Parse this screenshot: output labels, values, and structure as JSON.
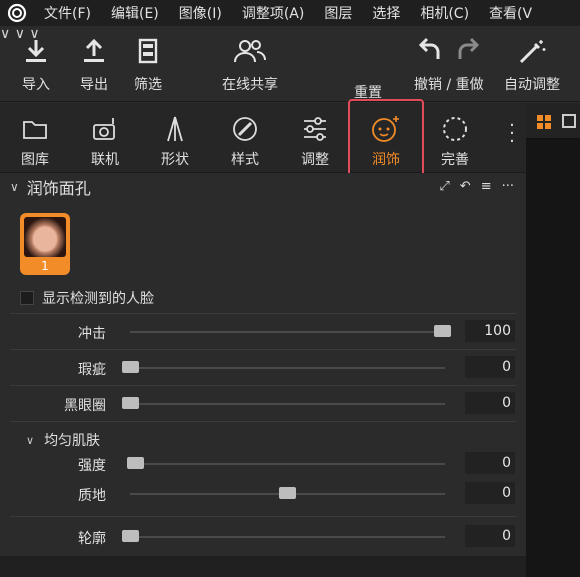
{
  "menu": [
    "文件(F)",
    "编辑(E)",
    "图像(I)",
    "调整项(A)",
    "图层",
    "选择",
    "相机(C)",
    "查看(V"
  ],
  "toolbar": {
    "import": "导入",
    "export": "导出",
    "filter": "筛选",
    "share": "在线共享",
    "reset": "重置",
    "undo_redo": "撤销 / 重做",
    "auto_adjust": "自动调整"
  },
  "tabs": [
    {
      "label": "图库",
      "icon": "folder-icon"
    },
    {
      "label": "联机",
      "icon": "camera-tether-icon"
    },
    {
      "label": "形状",
      "icon": "shape-icon"
    },
    {
      "label": "样式",
      "icon": "style-icon"
    },
    {
      "label": "调整",
      "icon": "sliders-icon"
    },
    {
      "label": "润饰",
      "icon": "retouch-face-icon",
      "active": true
    },
    {
      "label": "完善",
      "icon": "refine-circle-icon"
    }
  ],
  "panel": {
    "title": "润饰面孔",
    "face_count": "1",
    "show_faces_label": "显示检测到的人脸",
    "sliders": [
      {
        "label": "冲击",
        "value": "100",
        "position": 1.0
      },
      {
        "label": "瑕疵",
        "value": "0",
        "position": 0.0
      },
      {
        "label": "黑眼圈",
        "value": "0",
        "position": 0.0
      }
    ],
    "even_skin": {
      "title": "均匀肌肤",
      "sliders": [
        {
          "label": "强度",
          "value": "0",
          "position": 0.0
        },
        {
          "label": "质地",
          "value": "0",
          "position": 0.5
        }
      ]
    },
    "contour": {
      "label": "轮廓",
      "value": "0",
      "position": 0.0
    }
  },
  "colors": {
    "accent": "#f28c28",
    "highlight_border": "#e24b5c",
    "background": "#2b2b2b"
  }
}
